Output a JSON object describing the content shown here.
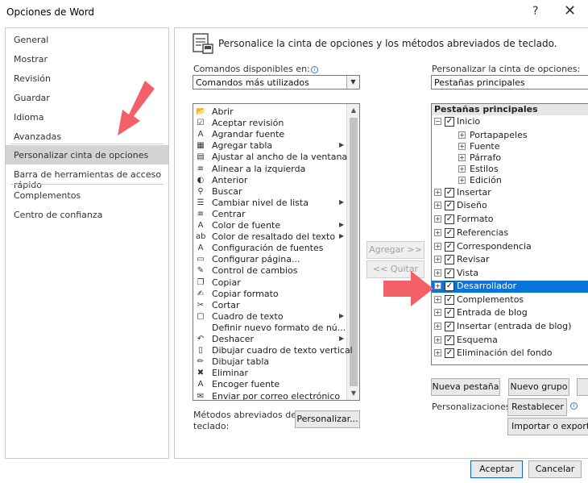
{
  "window": {
    "title": "Opciones de Word",
    "help": "?",
    "close": "✕"
  },
  "nav": {
    "items": [
      {
        "label": "General"
      },
      {
        "label": "Mostrar"
      },
      {
        "label": "Revisión"
      },
      {
        "label": "Guardar"
      },
      {
        "label": "Idioma"
      },
      {
        "label": "Avanzadas"
      },
      {
        "label": "Personalizar cinta de opciones"
      },
      {
        "label": "Barra de herramientas de acceso rápido"
      },
      {
        "label": "Complementos"
      },
      {
        "label": "Centro de confianza"
      }
    ],
    "selected_index": 6
  },
  "heading": "Personalice la cinta de opciones y los métodos abreviados de teclado.",
  "left": {
    "label": "Comandos disponibles en:",
    "info": "i",
    "select_value": "Comandos más utilizados",
    "commands": [
      {
        "label": "Abrir",
        "icon": "folder-icon",
        "glyph": "📂",
        "submenu": false
      },
      {
        "label": "Aceptar revisión",
        "icon": "accept-icon",
        "glyph": "☑",
        "submenu": false
      },
      {
        "label": "Agrandar fuente",
        "icon": "grow-font-icon",
        "glyph": "A",
        "submenu": false
      },
      {
        "label": "Agregar tabla",
        "icon": "table-icon",
        "glyph": "▦",
        "submenu": true
      },
      {
        "label": "Ajustar al ancho de la ventana",
        "icon": "fit-width-icon",
        "glyph": "▤",
        "submenu": false
      },
      {
        "label": "Alinear a la izquierda",
        "icon": "align-left-icon",
        "glyph": "≡",
        "submenu": false
      },
      {
        "label": "Anterior",
        "icon": "previous-icon",
        "glyph": "◐",
        "submenu": false
      },
      {
        "label": "Buscar",
        "icon": "search-icon",
        "glyph": "⚲",
        "submenu": false
      },
      {
        "label": "Cambiar nivel de lista",
        "icon": "list-level-icon",
        "glyph": "☰",
        "submenu": true
      },
      {
        "label": "Centrar",
        "icon": "align-center-icon",
        "glyph": "≡",
        "submenu": false
      },
      {
        "label": "Color de fuente",
        "icon": "font-color-icon",
        "glyph": "A",
        "submenu": true
      },
      {
        "label": "Color de resaltado del texto",
        "icon": "highlight-icon",
        "glyph": "ab",
        "submenu": true
      },
      {
        "label": "Configuración de fuentes",
        "icon": "font-settings-icon",
        "glyph": "A",
        "submenu": false
      },
      {
        "label": "Configurar página...",
        "icon": "page-setup-icon",
        "glyph": "▭",
        "submenu": false
      },
      {
        "label": "Control de cambios",
        "icon": "track-changes-icon",
        "glyph": "✎",
        "submenu": false
      },
      {
        "label": "Copiar",
        "icon": "copy-icon",
        "glyph": "❐",
        "submenu": false
      },
      {
        "label": "Copiar formato",
        "icon": "format-painter-icon",
        "glyph": "✍",
        "submenu": false
      },
      {
        "label": "Cortar",
        "icon": "cut-icon",
        "glyph": "✂",
        "submenu": false
      },
      {
        "label": "Cuadro de texto",
        "icon": "text-box-icon",
        "glyph": "▢",
        "submenu": true
      },
      {
        "label": "Definir nuevo formato de nú...",
        "icon": "",
        "glyph": "",
        "submenu": false
      },
      {
        "label": "Deshacer",
        "icon": "undo-icon",
        "glyph": "↶",
        "submenu": true
      },
      {
        "label": "Dibujar cuadro de texto vertical",
        "icon": "vertical-text-box-icon",
        "glyph": "▯",
        "submenu": false
      },
      {
        "label": "Dibujar tabla",
        "icon": "draw-table-icon",
        "glyph": "✏",
        "submenu": false
      },
      {
        "label": "Eliminar",
        "icon": "delete-icon",
        "glyph": "✖",
        "submenu": false
      },
      {
        "label": "Encoger fuente",
        "icon": "shrink-font-icon",
        "glyph": "A",
        "submenu": false
      },
      {
        "label": "Enviar por correo electrónico",
        "icon": "email-icon",
        "glyph": "✉",
        "submenu": false
      }
    ]
  },
  "middle": {
    "add": "Agregar >>",
    "remove": "<< Quitar"
  },
  "right": {
    "label": "Personalizar la cinta de opciones:",
    "info": "i",
    "select_value": "Pestañas principales",
    "tree_header": "Pestañas principales",
    "tree": [
      {
        "label": "Inicio",
        "level": 0,
        "expanded": true,
        "checkbox": true
      },
      {
        "label": "Portapapeles",
        "level": 1,
        "expanded": false,
        "checkbox": false
      },
      {
        "label": "Fuente",
        "level": 1,
        "expanded": false,
        "checkbox": false
      },
      {
        "label": "Párrafo",
        "level": 1,
        "expanded": false,
        "checkbox": false
      },
      {
        "label": "Estilos",
        "level": 1,
        "expanded": false,
        "checkbox": false
      },
      {
        "label": "Edición",
        "level": 1,
        "expanded": false,
        "checkbox": false
      },
      {
        "label": "Insertar",
        "level": 0,
        "expanded": false,
        "checkbox": true
      },
      {
        "label": "Diseño",
        "level": 0,
        "expanded": false,
        "checkbox": true
      },
      {
        "label": "Formato",
        "level": 0,
        "expanded": false,
        "checkbox": true
      },
      {
        "label": "Referencias",
        "level": 0,
        "expanded": false,
        "checkbox": true
      },
      {
        "label": "Correspondencia",
        "level": 0,
        "expanded": false,
        "checkbox": true
      },
      {
        "label": "Revisar",
        "level": 0,
        "expanded": false,
        "checkbox": true
      },
      {
        "label": "Vista",
        "level": 0,
        "expanded": false,
        "checkbox": true
      },
      {
        "label": "Desarrollador",
        "level": 0,
        "expanded": false,
        "checkbox": true,
        "selected": true
      },
      {
        "label": "Complementos",
        "level": 0,
        "expanded": false,
        "checkbox": true
      },
      {
        "label": "Entrada de blog",
        "level": 0,
        "expanded": false,
        "checkbox": true
      },
      {
        "label": "Insertar (entrada de blog)",
        "level": 0,
        "expanded": false,
        "checkbox": true
      },
      {
        "label": "Esquema",
        "level": 0,
        "expanded": false,
        "checkbox": true
      },
      {
        "label": "Eliminación del fondo",
        "level": 0,
        "expanded": false,
        "checkbox": true
      }
    ],
    "new_tab": "Nueva pestaña",
    "new_group": "Nuevo grupo",
    "customizations_label": "Personalizaciones:",
    "reset": "Restablecer ▾",
    "import_export": "Importar o exportar ▾"
  },
  "shortcuts": {
    "label_line1": "Métodos abreviados de",
    "label_line2": "teclado:",
    "customize": "Personalizar..."
  },
  "footer": {
    "ok": "Aceptar",
    "cancel": "Cancelar"
  },
  "colors": {
    "selection": "#0a74da",
    "nav_selected": "#d3d3d3",
    "accent_arrow": "#f4606a"
  }
}
